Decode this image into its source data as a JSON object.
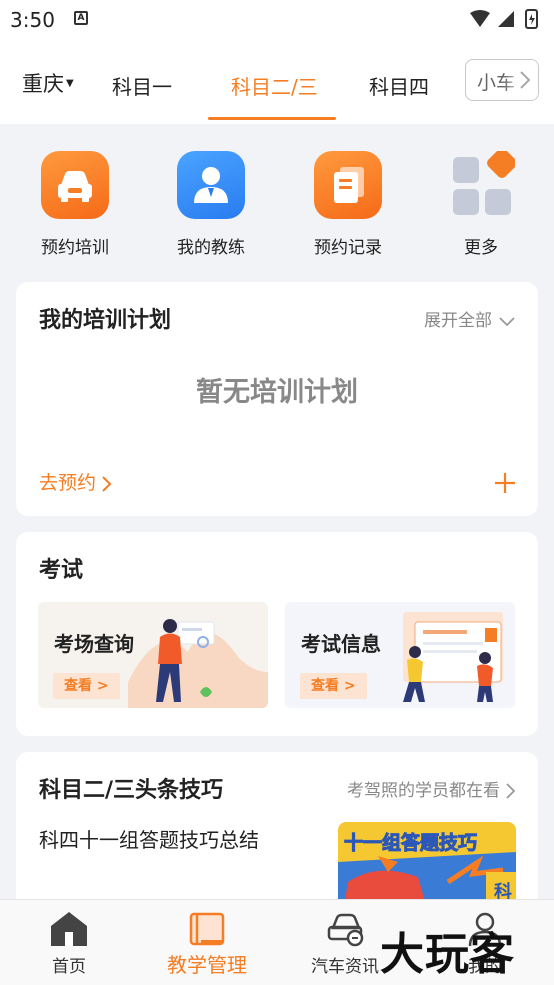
{
  "status_bar": {
    "time": "3:50",
    "sim_icon": "sim-alert-icon"
  },
  "top_bar": {
    "city": "重庆",
    "tabs": [
      "科目一",
      "科目二/三",
      "科目四"
    ],
    "active_tab_index": 1,
    "more_tab": "小车",
    "accent_color": "#f57d23"
  },
  "quick_actions": [
    {
      "label": "预约培训",
      "icon": "car-icon"
    },
    {
      "label": "我的教练",
      "icon": "coach-icon"
    },
    {
      "label": "预约记录",
      "icon": "record-icon"
    },
    {
      "label": "更多",
      "icon": "grid-more-icon"
    }
  ],
  "training_plan": {
    "title": "我的培训计划",
    "expand_label": "展开全部",
    "empty_text": "暂无培训计划",
    "goto_label": "去预约"
  },
  "exam": {
    "title": "考试",
    "boxes": [
      {
        "title": "考场查询",
        "button": "查看 >"
      },
      {
        "title": "考试信息",
        "button": "查看 >"
      }
    ]
  },
  "tips": {
    "title": "科目二/三头条技巧",
    "link": "考驾照的学员都在看",
    "article_title": "科四十一组答题技巧总结",
    "thumb_text": "十一组答题技巧",
    "thumb_badge": "科"
  },
  "bottom_nav": [
    {
      "label": "首页",
      "icon": "home-icon"
    },
    {
      "label": "教学管理",
      "icon": "book-icon"
    },
    {
      "label": "汽车资讯",
      "icon": "car-news-icon"
    },
    {
      "label": "我的",
      "icon": "profile-icon"
    }
  ],
  "active_nav_index": 1,
  "watermark": "大玩客"
}
